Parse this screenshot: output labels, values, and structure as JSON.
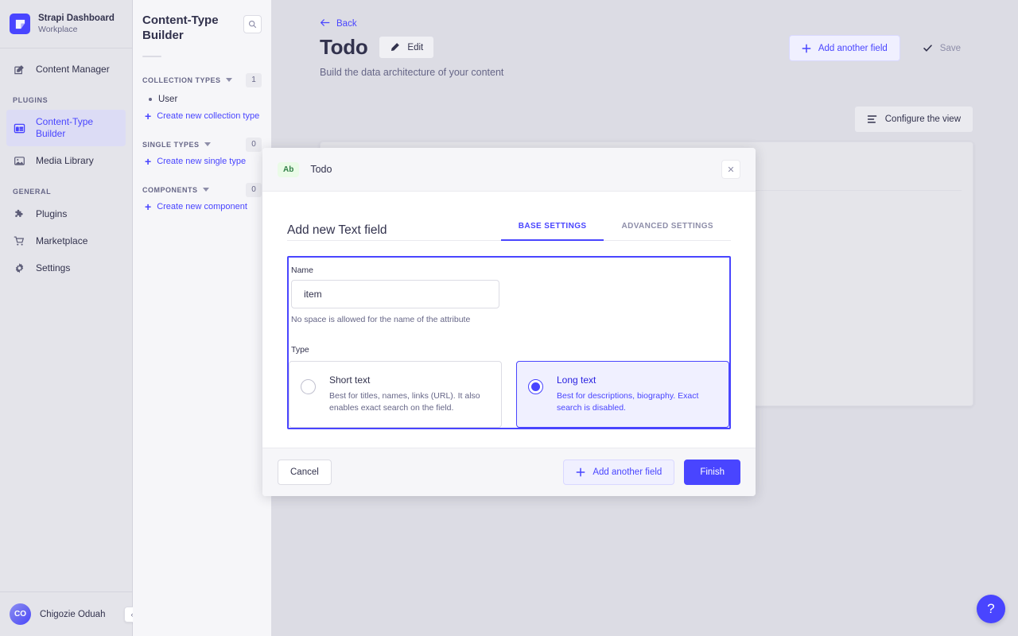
{
  "brand": {
    "title": "Strapi Dashboard",
    "subtitle": "Workplace",
    "logo_icon": "strapi-logo-icon"
  },
  "leftnav": {
    "top_items": [
      {
        "label": "Content Manager",
        "icon": "pencil-square-icon",
        "active": false
      }
    ],
    "sections": [
      {
        "label": "PLUGINS",
        "items": [
          {
            "label": "Content-Type Builder",
            "icon": "layout-grid-icon",
            "active": true
          },
          {
            "label": "Media Library",
            "icon": "image-icon",
            "active": false
          }
        ]
      },
      {
        "label": "GENERAL",
        "items": [
          {
            "label": "Plugins",
            "icon": "puzzle-icon",
            "active": false
          },
          {
            "label": "Marketplace",
            "icon": "shopping-cart-icon",
            "active": false
          },
          {
            "label": "Settings",
            "icon": "gear-icon",
            "active": false
          }
        ]
      }
    ],
    "user": {
      "initials": "CO",
      "name": "Chigozie Oduah",
      "collapse_icon": "chevron-left-icon"
    }
  },
  "subnav": {
    "title": "Content-Type Builder",
    "search_icon": "search-icon",
    "groups": [
      {
        "title": "COLLECTION TYPES",
        "count": "1",
        "items": [
          {
            "label": "User"
          }
        ],
        "create_label": "Create new collection type"
      },
      {
        "title": "SINGLE TYPES",
        "count": "0",
        "items": [],
        "create_label": "Create new single type"
      },
      {
        "title": "COMPONENTS",
        "count": "0",
        "items": [],
        "create_label": "Create new component"
      }
    ]
  },
  "main": {
    "back_label": "Back",
    "back_icon": "arrow-left-icon",
    "page_title": "Todo",
    "edit_label": "Edit",
    "edit_icon": "pencil-icon",
    "subtitle": "Build the data architecture of your content",
    "add_field_label": "Add another field",
    "add_field_icon": "plus-icon",
    "save_label": "Save",
    "save_icon": "check-icon",
    "configure_label": "Configure the view",
    "configure_icon": "sliders-icon",
    "help_label": "?"
  },
  "modal": {
    "badge": "Ab",
    "header_title": "Todo",
    "close_icon": "close-icon",
    "title": "Add new Text field",
    "tabs": [
      {
        "label": "BASE SETTINGS",
        "active": true
      },
      {
        "label": "ADVANCED SETTINGS",
        "active": false
      }
    ],
    "name_label": "Name",
    "name_value": "item",
    "name_placeholder": "",
    "name_hint": "No space is allowed for the name of the attribute",
    "type_label": "Type",
    "type_options": [
      {
        "title": "Short text",
        "description": "Best for titles, names, links (URL). It also enables exact search on the field.",
        "selected": false
      },
      {
        "title": "Long text",
        "description": "Best for descriptions, biography. Exact search is disabled.",
        "selected": true
      }
    ],
    "cancel_label": "Cancel",
    "add_another_label": "Add another field",
    "add_another_icon": "plus-icon",
    "finish_label": "Finish"
  },
  "colors": {
    "accent": "#4945ff",
    "accent_dark": "#271fe0",
    "badge_bg": "#eafbe7",
    "badge_fg": "#328048",
    "page_bg": "#dcdce4",
    "nav_bg": "#e4e4ea",
    "subnav_bg": "#f6f6f9",
    "text": "#32324d",
    "muted": "#666687"
  }
}
